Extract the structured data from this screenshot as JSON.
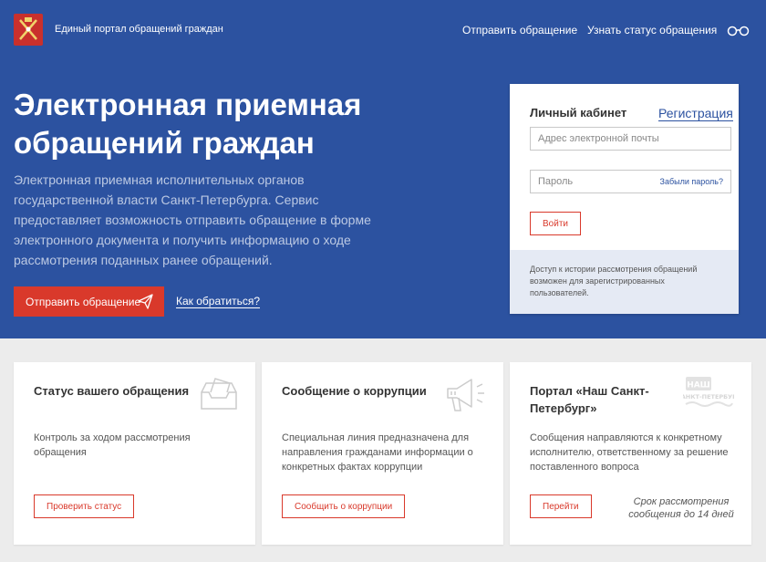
{
  "header": {
    "title": "Единый портал обращений граждан",
    "nav": [
      {
        "label": "Отправить обращение"
      },
      {
        "label": "Узнать статус обращения"
      }
    ],
    "accessibility_icon": "glasses-icon",
    "logo_icon": "coat-of-arms-icon"
  },
  "hero": {
    "title": "Электронная приемная обращений граждан",
    "description": "Электронная приемная исполнительных органов государственной власти Санкт-Петербурга. Сервис предоставляет возможность отправить обращение в форме электронного документа и получить информацию о ходе рассмотрения поданных ранее обращений.",
    "send_button": "Отправить обращение",
    "how_link": "Как обратиться?"
  },
  "login": {
    "title": "Личный кабинет",
    "register": "Регистрация",
    "email_placeholder": "Адрес электронной почты",
    "password_placeholder": "Пароль",
    "forgot": "Забыли пароль?",
    "login_button": "Войти",
    "note": "Доступ к истории рассмотрения обращений возможен для зарегистрированных пользователей."
  },
  "cards": [
    {
      "title": "Статус вашего обращения",
      "text": "Контроль за ходом рассмотрения обращения",
      "button": "Проверить статус",
      "icon": "inbox-icon"
    },
    {
      "title": "Сообщение о коррупции",
      "text": "Специальная линия предназначена для направления гражданами информации о конкретных фактах коррупции",
      "button": "Сообщить о коррупции",
      "icon": "megaphone-icon"
    },
    {
      "title": "Портал «Наш Санкт-Петербург»",
      "text": "Сообщения направляются к конкретному исполнителю, ответственному за решение поставленного вопроса",
      "button": "Перейти",
      "note": "Срок рассмотрения сообщения до 14 дней",
      "icon": "nash-spb-logo-icon",
      "logo_text_top": "НАШ",
      "logo_text_bottom": "САНКТ-ПЕТЕРБУРГ"
    }
  ],
  "colors": {
    "hero_bg": "#2c52a0",
    "accent_red": "#d9392b",
    "page_bg": "#ececec"
  }
}
